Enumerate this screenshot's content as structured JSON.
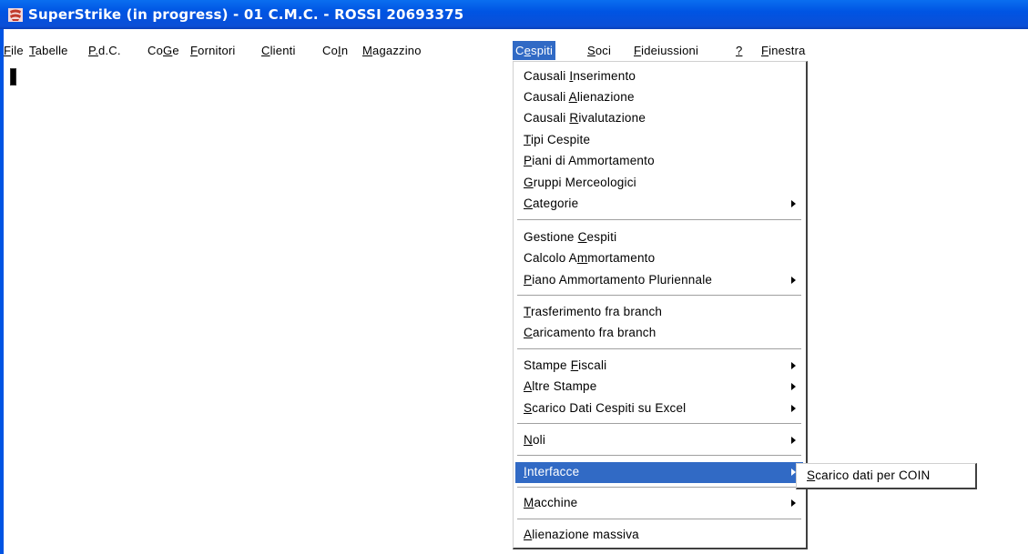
{
  "window": {
    "title": "SuperStrike (in progress) - 01 C.M.C. - ROSSI 20693375",
    "icon": "superstrike-app-icon",
    "colors": {
      "titlebar": "#0054e3",
      "highlight": "#316ac5"
    }
  },
  "menubar": {
    "items": [
      {
        "label": "File",
        "mnemonic": "F"
      },
      {
        "label": "Tabelle",
        "mnemonic": "T"
      },
      {
        "label": "P.d.C.",
        "mnemonic": "P"
      },
      {
        "label": "CoGe",
        "mnemonic": "G"
      },
      {
        "label": "Fornitori",
        "mnemonic": "F"
      },
      {
        "label": "Clienti",
        "mnemonic": "C"
      },
      {
        "label": "CoIn",
        "mnemonic": "I"
      },
      {
        "label": "Magazzino",
        "mnemonic": "M"
      },
      {
        "label": "Cespiti",
        "mnemonic": "e",
        "active": true
      },
      {
        "label": "Soci",
        "mnemonic": "S"
      },
      {
        "label": "Fideiussioni",
        "mnemonic": "F"
      },
      {
        "label": "?",
        "mnemonic": "?"
      },
      {
        "label": "Finestra",
        "mnemonic": "F"
      }
    ]
  },
  "cespiti_menu": {
    "items": [
      {
        "label": "Causali Inserimento",
        "mnemonic": "I"
      },
      {
        "label": "Causali Alienazione",
        "mnemonic": "A"
      },
      {
        "label": "Causali Rivalutazione",
        "mnemonic": "R"
      },
      {
        "label": "Tipi Cespite",
        "mnemonic": "T"
      },
      {
        "label": "Piani di Ammortamento",
        "mnemonic": "P"
      },
      {
        "label": "Gruppi Merceologici",
        "mnemonic": "G"
      },
      {
        "label": "Categorie",
        "mnemonic": "C",
        "submenu": true
      },
      {
        "label": "Gestione Cespiti",
        "mnemonic": "C"
      },
      {
        "label": "Calcolo Ammortamento",
        "mnemonic": "m"
      },
      {
        "label": "Piano Ammortamento Pluriennale",
        "mnemonic": "P",
        "submenu": true
      },
      {
        "label": "Trasferimento fra branch",
        "mnemonic": "T"
      },
      {
        "label": "Caricamento fra branch",
        "mnemonic": "C"
      },
      {
        "label": "Stampe Fiscali",
        "mnemonic": "F",
        "submenu": true
      },
      {
        "label": "Altre Stampe",
        "mnemonic": "A",
        "submenu": true
      },
      {
        "label": "Scarico Dati Cespiti su Excel",
        "mnemonic": "S",
        "submenu": true
      },
      {
        "label": "Noli",
        "mnemonic": "N",
        "submenu": true
      },
      {
        "label": "Interfacce",
        "mnemonic": "I",
        "submenu": true,
        "highlighted": true
      },
      {
        "label": "Macchine",
        "mnemonic": "M",
        "submenu": true
      },
      {
        "label": "Alienazione massiva",
        "mnemonic": "A"
      }
    ]
  },
  "interfacce_submenu": {
    "items": [
      {
        "label": "Scarico dati per COIN",
        "mnemonic": "S"
      }
    ]
  }
}
